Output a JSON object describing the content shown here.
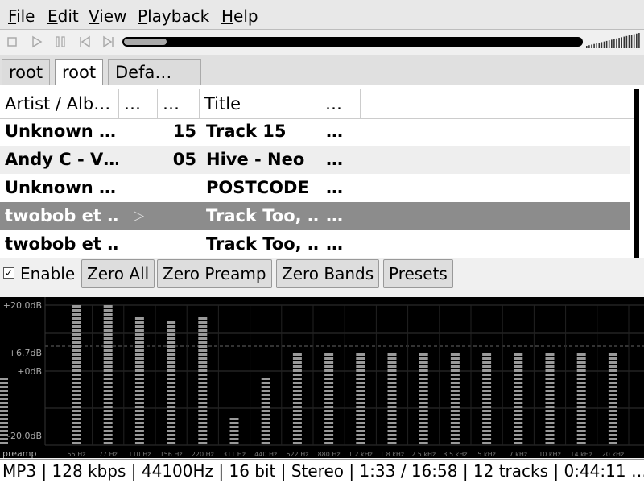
{
  "menu": {
    "items": [
      {
        "label": "File",
        "ul": "F",
        "rest": "ile"
      },
      {
        "label": "Edit",
        "ul": "E",
        "rest": "dit"
      },
      {
        "label": "View",
        "ul": "V",
        "rest": "iew"
      },
      {
        "label": "Playback",
        "ul": "P",
        "rest": "layback"
      },
      {
        "label": "Help",
        "ul": "H",
        "rest": "elp"
      }
    ]
  },
  "toolbar": {
    "buttons": [
      "stop-icon",
      "play-icon",
      "pause-icon",
      "previous-icon",
      "next-icon"
    ],
    "seek_progress": 0.094,
    "volume_level": 1.0
  },
  "tabs": [
    "root",
    "root",
    "Defa…"
  ],
  "playlist": {
    "columns": [
      "Artist / Alb…",
      "…",
      "…",
      "Title",
      "…"
    ],
    "rows": [
      {
        "artist": "Unknown …",
        "c2": "",
        "track": "15",
        "title": "Track 15",
        "c5": "…"
      },
      {
        "artist": "Andy C - V…",
        "c2": "",
        "track": "05",
        "title": "Hive - Neo",
        "c5": "…"
      },
      {
        "artist": "Unknown …",
        "c2": "",
        "track": "",
        "title": "POSTCODE",
        "c5": "…"
      },
      {
        "artist": "twobob et …",
        "c2": "▷",
        "track": "",
        "title": "Track Too, …",
        "c5": "…",
        "selected": true
      },
      {
        "artist": "twobob et …",
        "c2": "",
        "track": "",
        "title": "Track Too, …",
        "c5": "…"
      }
    ]
  },
  "equalizer": {
    "enable_label": "Enable",
    "enabled": true,
    "buttons": [
      "Zero All",
      "Zero Preamp",
      "Zero Bands",
      "Presets"
    ],
    "scale_labels": [
      "+20.0dB",
      "+6.7dB",
      "+0dB",
      "-20.0dB"
    ],
    "preamp_label": "preamp",
    "band_labels": [
      "55 Hz",
      "77 Hz",
      "110 Hz",
      "156 Hz",
      "220 Hz",
      "311 Hz",
      "440 Hz",
      "622 Hz",
      "880 Hz",
      "1.2 kHz",
      "1.8 kHz",
      "2.5 kHz",
      "3.5 kHz",
      "5 kHz",
      "7 kHz",
      "10 kHz",
      "14 kHz",
      "20 kHz"
    ],
    "preamp_db": -0.5,
    "band_db": [
      20,
      20,
      17.5,
      16,
      17.5,
      -12,
      -0.3,
      6.7,
      6.7,
      6.7,
      6.7,
      6.7,
      6.3,
      6.3,
      6.3,
      6.7,
      6.7,
      6.7
    ]
  },
  "status": {
    "text": "MP3 |  128 kbps | 44100Hz | 16 bit | Stereo | 1:33 / 16:58 | 12 tracks | 0:44:11 …"
  },
  "colors": {
    "selection": "#8c8c8c",
    "eq_background": "#000000",
    "eq_bar": "#9a9a9a"
  }
}
